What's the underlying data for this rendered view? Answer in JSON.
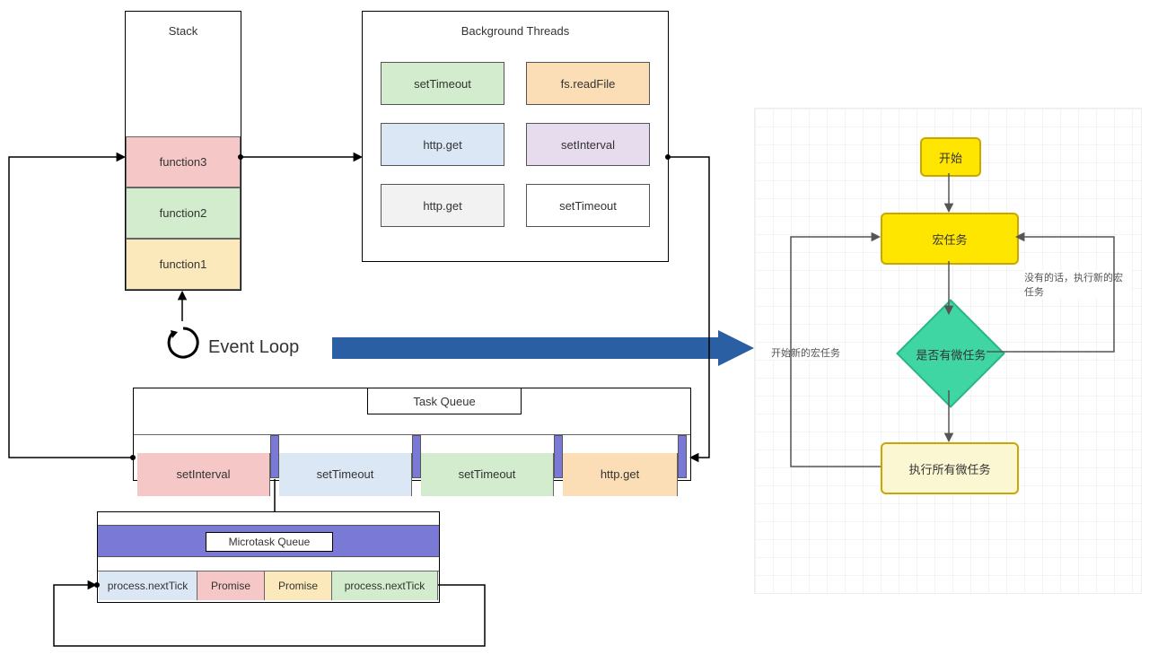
{
  "stack": {
    "title": "Stack",
    "cells": [
      "function3",
      "function2",
      "function1"
    ],
    "colors": [
      "#f6c7c7",
      "#d2eccd",
      "#fce9bb"
    ]
  },
  "background": {
    "title": "Background Threads",
    "rows": [
      [
        {
          "t": "setTimeout",
          "c": "#d2eccd"
        },
        {
          "t": "fs.readFile",
          "c": "#fbdeb6"
        }
      ],
      [
        {
          "t": "http.get",
          "c": "#dce7f6"
        },
        {
          "t": "setInterval",
          "c": "#e7dbee"
        }
      ],
      [
        {
          "t": "http.get",
          "c": "#f2f2f2"
        },
        {
          "t": "setTimeout",
          "c": "#ffffff"
        }
      ]
    ]
  },
  "eventLoop": "Event Loop",
  "taskQueue": {
    "title": "Task Queue",
    "items": [
      {
        "t": "setInterval",
        "c": "#f6c7c7"
      },
      {
        "t": "setTimeout",
        "c": "#dce7f6"
      },
      {
        "t": "setTimeout",
        "c": "#d2eccd"
      },
      {
        "t": "http.get",
        "c": "#fbdeb6"
      }
    ]
  },
  "microtask": {
    "title": "Microtask Queue",
    "items": [
      {
        "t": "process.nextTick",
        "c": "#dce7f6"
      },
      {
        "t": "Promise",
        "c": "#f6c7c7"
      },
      {
        "t": "Promise",
        "c": "#fce9bb"
      },
      {
        "t": "process.nextTick",
        "c": "#d2eccd"
      }
    ]
  },
  "flow": {
    "start": "开始",
    "macro": "宏任务",
    "decision": "是否有微任务",
    "exec": "执行所有微任务",
    "leftLabel": "开始新的宏任务",
    "rightLabel": "没有的话，执行新的宏任务"
  },
  "colors": {
    "arrowBlue": "#2a5fa3",
    "barPurple": "#7a79d6",
    "macroYellow": "#ffe600",
    "execYellow": "#fbf7d2"
  }
}
